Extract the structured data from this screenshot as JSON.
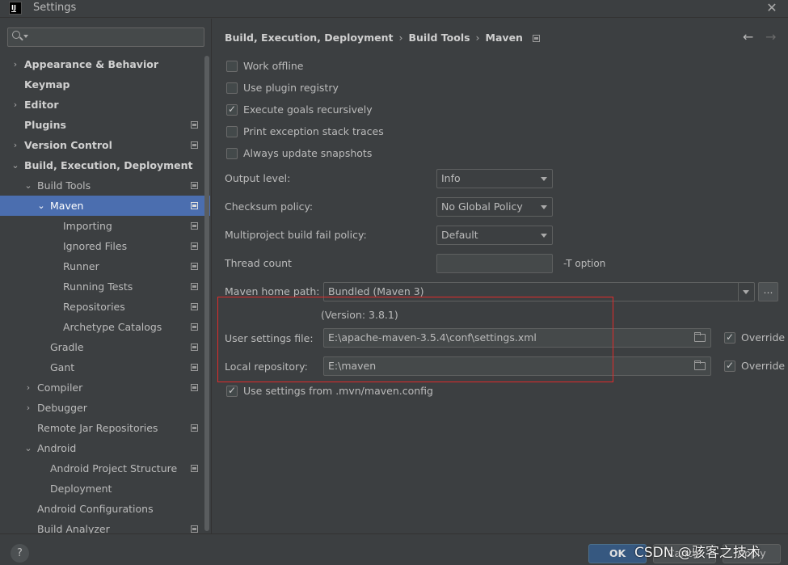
{
  "window": {
    "title": "Settings",
    "app_icon": "IJ",
    "close": "✕"
  },
  "search": {
    "value": "",
    "placeholder": ""
  },
  "tree": [
    {
      "label": "Appearance & Behavior",
      "arrow": "›"
    },
    {
      "label": "Keymap",
      "arrow": ""
    },
    {
      "label": "Editor",
      "arrow": "›"
    },
    {
      "label": "Plugins",
      "arrow": ""
    },
    {
      "label": "Version Control",
      "arrow": "›"
    },
    {
      "label": "Build, Execution, Deployment",
      "arrow": "⌄"
    },
    {
      "label": "Build Tools",
      "arrow": "⌄"
    },
    {
      "label": "Maven",
      "arrow": "⌄"
    },
    {
      "label": "Importing",
      "arrow": ""
    },
    {
      "label": "Ignored Files",
      "arrow": ""
    },
    {
      "label": "Runner",
      "arrow": ""
    },
    {
      "label": "Running Tests",
      "arrow": ""
    },
    {
      "label": "Repositories",
      "arrow": ""
    },
    {
      "label": "Archetype Catalogs",
      "arrow": ""
    },
    {
      "label": "Gradle",
      "arrow": ""
    },
    {
      "label": "Gant",
      "arrow": ""
    },
    {
      "label": "Compiler",
      "arrow": "›"
    },
    {
      "label": "Debugger",
      "arrow": "›"
    },
    {
      "label": "Remote Jar Repositories",
      "arrow": ""
    },
    {
      "label": "Android",
      "arrow": "⌄"
    },
    {
      "label": "Android Project Structure",
      "arrow": ""
    },
    {
      "label": "Deployment",
      "arrow": ""
    },
    {
      "label": "Android Configurations",
      "arrow": ""
    },
    {
      "label": "Build Analyzer",
      "arrow": ""
    }
  ],
  "breadcrumb": {
    "items": [
      "Build, Execution, Deployment",
      "Build Tools",
      "Maven"
    ],
    "separator": "›"
  },
  "nav": {
    "back": "←",
    "forward": "→"
  },
  "checkboxes": [
    {
      "label": "Work offline",
      "checked": false
    },
    {
      "label": "Use plugin registry",
      "checked": false
    },
    {
      "label": "Execute goals recursively",
      "checked": true
    },
    {
      "label": "Print exception stack traces",
      "checked": false
    },
    {
      "label": "Always update snapshots",
      "checked": false
    }
  ],
  "output_level": {
    "label": "Output level:",
    "value": "Info"
  },
  "checksum_policy": {
    "label": "Checksum policy:",
    "value": "No Global Policy"
  },
  "fail_policy": {
    "label": "Multiproject build fail policy:",
    "value": "Default"
  },
  "thread_count": {
    "label": "Thread count",
    "value": "",
    "hint": "-T option"
  },
  "maven_home": {
    "label": "Maven home path:",
    "value": "Bundled (Maven 3)",
    "browse": "...",
    "version": "(Version: 3.8.1)"
  },
  "user_settings": {
    "label": "User settings file:",
    "value": "E:\\apache-maven-3.5.4\\conf\\settings.xml",
    "override_label": "Override",
    "override_checked": true
  },
  "local_repo": {
    "label": "Local repository:",
    "value": "E:\\maven",
    "override_label": "Override",
    "override_checked": true
  },
  "mvn_config": {
    "label": "Use settings from .mvn/maven.config",
    "checked": true
  },
  "buttons": {
    "help": "?",
    "ok": "OK",
    "cancel": "Cancel",
    "apply": "Apply"
  },
  "watermark": "CSDN @骇客之技术"
}
